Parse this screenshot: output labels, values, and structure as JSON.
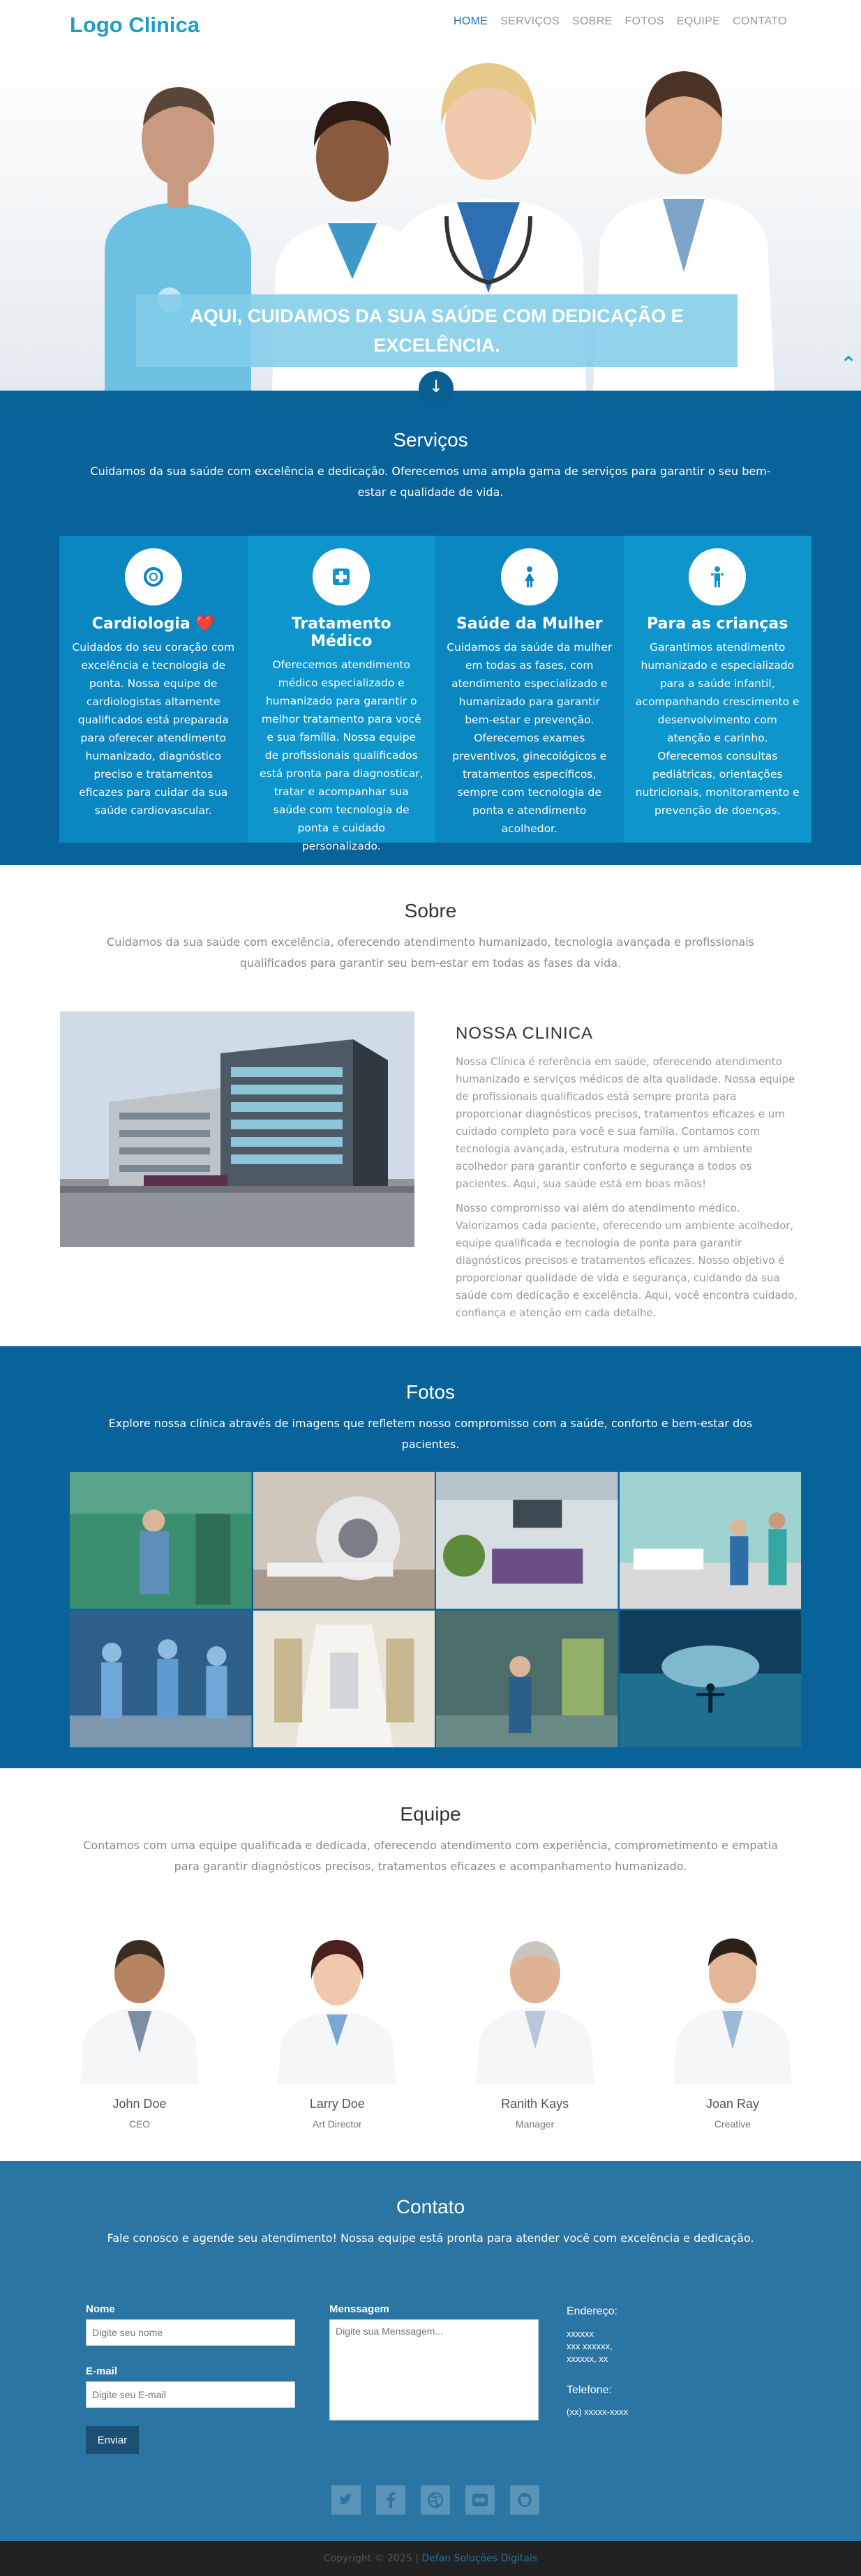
{
  "header": {
    "logo": "Logo Clinica",
    "nav": [
      "HOME",
      "SERVIÇOS",
      "SOBRE",
      "FOTOS",
      "EQUIPE",
      "CONTATO"
    ],
    "hero_caption": "AQUI, CUIDAMOS DA SUA SAÚDE COM DEDICAÇÃO E EXCELÊNCIA."
  },
  "services": {
    "title": "Serviços",
    "subtitle": "Cuidamos da sua saúde com excelência e dedicação. Oferecemos uma ampla gama de serviços para garantir o seu bem-estar e qualidade de vida.",
    "cards": [
      {
        "title": "Cardiologia ❤️",
        "icon": "lifebuoy-icon",
        "text": "Cuidados do seu coração com excelência e tecnologia de ponta. Nossa equipe de cardiologistas altamente qualificados está preparada para oferecer atendimento humanizado, diagnóstico preciso e tratamentos eficazes para cuidar da sua saúde cardiovascular."
      },
      {
        "title": "Tratamento Médico",
        "icon": "medical-cross-icon",
        "text": "Oferecemos atendimento médico especializado e humanizado para garantir o melhor tratamento para você e sua família. Nossa equipe de profissionais qualificados está pronta para diagnosticar, tratar e acompanhar sua saúde com tecnologia de ponta e cuidado personalizado."
      },
      {
        "title": "Saúde da Mulher",
        "icon": "female-icon",
        "text": "Cuidamos da saúde da mulher em todas as fases, com atendimento especializado e humanizado para garantir bem-estar e prevenção. Oferecemos exames preventivos, ginecológicos e tratamentos específicos, sempre com tecnologia de ponta e atendimento acolhedor."
      },
      {
        "title": "Para as crianças",
        "icon": "child-icon",
        "text": "Garantimos atendimento humanizado e especializado para a saúde infantil, acompanhando crescimento e desenvolvimento com atenção e carinho. Oferecemos consultas pediátricas, orientações nutricionais, monitoramento e prevenção de doenças."
      }
    ]
  },
  "sobre": {
    "title": "Sobre",
    "subtitle": "Cuidamos da sua saúde com excelência, oferecendo atendimento humanizado, tecnologia avançada e profissionais qualificados para garantir seu bem-estar em todas as fases da vida.",
    "heading": "NOSSA CLINICA",
    "p1": "Nossa Clínica é referência em saúde, oferecendo atendimento humanizado e serviços médicos de alta qualidade. Nossa equipe de profissionais qualificados está sempre pronta para proporcionar diagnósticos precisos, tratamentos eficazes e um cuidado completo para você e sua família. Contamos com tecnologia avançada, estrutura moderna e um ambiente acolhedor para garantir conforto e segurança a todos os pacientes. Aqui, sua saúde está em boas mãos!",
    "p2": "Nosso compromisso vai além do atendimento médico. Valorizamos cada paciente, oferecendo um ambiente acolhedor, equipe qualificada e tecnologia de ponta para garantir diagnósticos precisos e tratamentos eficazes. Nosso objetivo é proporcionar qualidade de vida e segurança, cuidando da sua saúde com dedicação e excelência. Aqui, você encontra cuidado, confiança e atenção em cada detalhe."
  },
  "fotos": {
    "title": "Fotos",
    "subtitle": "Explore nossa clínica através de imagens que refletem nosso compromisso com a saúde, conforto e bem-estar dos pacientes."
  },
  "equipe": {
    "title": "Equipe",
    "subtitle": "Contamos com uma equipe qualificada e dedicada, oferecendo atendimento com experiência, comprometimento e empatia para garantir diagnósticos precisos, tratamentos eficazes e acompanhamento humanizado.",
    "members": [
      {
        "name": "John Doe",
        "role": "CEO"
      },
      {
        "name": "Larry Doe",
        "role": "Art Director"
      },
      {
        "name": "Ranith Kays",
        "role": "Manager"
      },
      {
        "name": "Joan Ray",
        "role": "Creative"
      }
    ]
  },
  "contato": {
    "title": "Contato",
    "subtitle": "Fale conosco e agende seu atendimento! Nossa equipe está pronta para atender você com excelência e dedicação.",
    "name_label": "Nome",
    "name_placeholder": "Digite seu nome",
    "email_label": "E-mail",
    "email_placeholder": "Digite seu E-mail",
    "message_label": "Menssagem",
    "message_placeholder": "Digite sua Menssagem...",
    "send": "Enviar",
    "address_label": "Endereço:",
    "address_lines": [
      "xxxxxx",
      "xxx xxxxxx,",
      "xxxxxx, xx"
    ],
    "phone_label": "Telefone:",
    "phone": "(xx) xxxxx-xxxx",
    "socials": [
      "twitter-icon",
      "facebook-icon",
      "dribbble-icon",
      "flickr-icon",
      "github-icon"
    ]
  },
  "footer": {
    "copyright": "Copyright © 2025 |",
    "company": "Defan Soluções Digitais"
  }
}
